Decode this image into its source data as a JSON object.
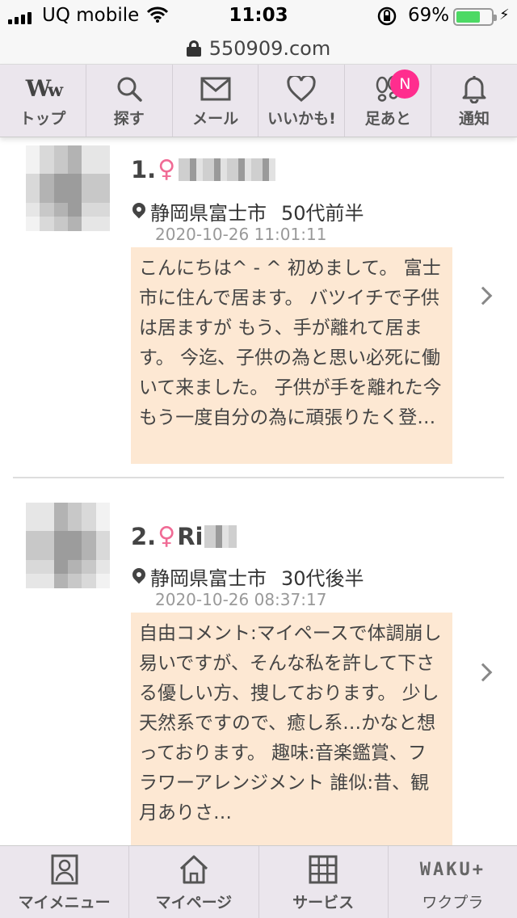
{
  "status": {
    "carrier": "UQ mobile",
    "time": "11:03",
    "battery": "69%",
    "battery_level": 0.69,
    "battery_color": "#4cd964"
  },
  "url": {
    "domain": "550909.com"
  },
  "top_nav": [
    {
      "label": "トップ",
      "icon": "ww-logo"
    },
    {
      "label": "探す",
      "icon": "search-icon"
    },
    {
      "label": "メール",
      "icon": "mail-icon"
    },
    {
      "label": "いいかも!",
      "icon": "heart-icon"
    },
    {
      "label": "足あと",
      "icon": "footprint-icon",
      "badge": "N"
    },
    {
      "label": "通知",
      "icon": "bell-icon"
    }
  ],
  "colors": {
    "accent_pink": "#ff2d8e",
    "female_pink": "#f06b95",
    "message_bg": "#fde8d3",
    "nav_bg": "#ebe6ed"
  },
  "posts": [
    {
      "rank": "1.",
      "gender_symbol": "♀",
      "name": "",
      "location": "静岡県富士市",
      "age": "50代前半",
      "timestamp": "2020-10-26 11:01:11",
      "message": "こんにちは^ - ^ 初めまして。 富士市に住んで居ます。 バツイチで子供は居ますが もう、手が離れて居ます。 今迄、子供の為と思い必死に働いて来ました。 子供が手を離れた今 もう一度自分の為に頑張りたく登…"
    },
    {
      "rank": "2.",
      "gender_symbol": "♀",
      "name": "Ri",
      "location": "静岡県富士市",
      "age": "30代後半",
      "timestamp": "2020-10-26 08:37:17",
      "message": "自由コメント:マイペースで体調崩し易いですが、そんな私を許して下さる優しい方、捜しております。 少し天然系ですので、癒し系…かなと想っております。 趣味:音楽鑑賞、フラワーアレンジメント 誰似:昔、観月ありさ…"
    }
  ],
  "bottom_nav": [
    {
      "label": "マイメニュー",
      "icon": "profile-icon"
    },
    {
      "label": "マイページ",
      "icon": "home-icon"
    },
    {
      "label": "サービス",
      "icon": "grid-icon"
    },
    {
      "label": "ワクプラ",
      "logo": "WAKU+"
    }
  ]
}
